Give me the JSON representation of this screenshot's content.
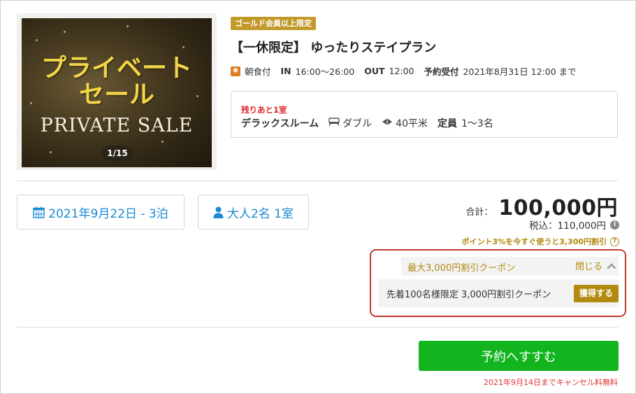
{
  "hero": {
    "title_line1": "プライベート",
    "title_line2": "セール",
    "title_en": "PRIVATE SALE",
    "counter": "1/15"
  },
  "plan": {
    "badge": "ゴールド会員以上限定",
    "title": "【一休限定】 ゆったりステイプラン",
    "meal_icon": "✱",
    "meal": "朝食付",
    "in_label": "IN",
    "in_time": "16:00〜26:00",
    "out_label": "OUT",
    "out_time": "12:00",
    "deadline_label": "予約受付",
    "deadline": "2021年8月31日 12:00 まで"
  },
  "room": {
    "remaining": "残りあと1室",
    "name": "デラックスルーム",
    "bed": "ダブル",
    "size": "40平米",
    "capacity_label": "定員",
    "capacity": "1〜3名"
  },
  "search": {
    "date": "2021年9月22日 - 3泊",
    "guests": "大人2名 1室"
  },
  "price": {
    "total_label": "合計：",
    "total": "100,000円",
    "tax": "税込：110,000円",
    "points": "ポイント3%を今すぐ使うと3,300円割引"
  },
  "coupon": {
    "title": "最大3,000円割引クーポン",
    "close": "閉じる",
    "item": "先着100名様限定  3,000円割引クーポン",
    "get": "獲得する"
  },
  "actions": {
    "reserve": "予約へすすむ",
    "cancel_note": "2021年9月14日までキャンセル料無料"
  },
  "colors": {
    "accent_blue": "#1a8ad4",
    "gold": "#b38a10",
    "reserve_green": "#13b51f",
    "alert_red": "#e02525"
  }
}
